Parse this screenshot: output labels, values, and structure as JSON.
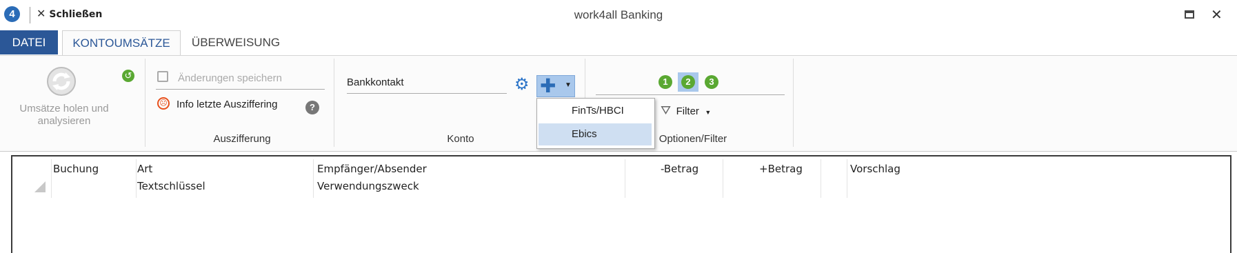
{
  "window": {
    "title": "work4all Banking",
    "close_label": "Schließen",
    "app_icon_glyph": "4"
  },
  "tabs": [
    {
      "label": "DATEI",
      "active": false,
      "accent": true
    },
    {
      "label": "KONTOUMSÄTZE",
      "active": true
    },
    {
      "label": "ÜBERWEISUNG",
      "active": false
    }
  ],
  "ribbon": {
    "fetch_button_label": "Umsätze holen und analysieren",
    "save_changes_label": "Änderungen speichern",
    "info_label": "Info letzte Ausziffering",
    "group_auszifferung": "Auszifferung",
    "bank_contact_label": "Bankkontakt",
    "group_konto": "Konto",
    "options": [
      "1",
      "2",
      "3"
    ],
    "filter_label": "Filter",
    "group_optionen": "Optionen/Filter"
  },
  "dropdown_menu": {
    "items": [
      {
        "label": "FinTs/HBCI",
        "highlighted": false
      },
      {
        "label": "Ebics",
        "highlighted": true
      }
    ]
  },
  "grid": {
    "headers_row1": [
      "Buchung",
      "Art",
      "Empfänger/Absender",
      "-Betrag",
      "+Betrag",
      "Vorschlag"
    ],
    "headers_row2": [
      "Textschlüssel",
      "Verwendungszweck"
    ]
  },
  "colors": {
    "accent": "#2b5797",
    "tab_active_text": "#2b5797",
    "green_badge": "#5aa832",
    "plus_button_bg": "#a9c8ec"
  }
}
